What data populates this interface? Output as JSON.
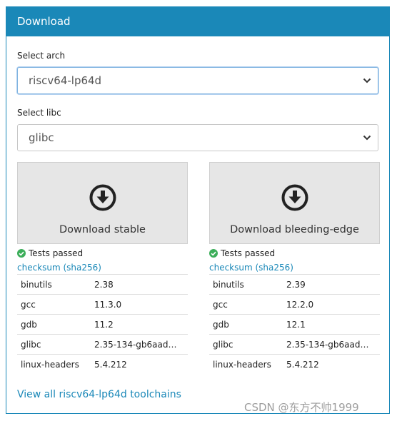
{
  "header": {
    "title": "Download"
  },
  "arch": {
    "label": "Select arch",
    "value": "riscv64-lp64d"
  },
  "libc": {
    "label": "Select libc",
    "value": "glibc"
  },
  "stable": {
    "button_label": "Download stable",
    "tests": "Tests passed",
    "checksum": "checksum (sha256)",
    "rows": [
      {
        "name": "binutils",
        "version": "2.38"
      },
      {
        "name": "gcc",
        "version": "11.3.0"
      },
      {
        "name": "gdb",
        "version": "11.2"
      },
      {
        "name": "glibc",
        "version": "2.35-134-gb6aad…"
      },
      {
        "name": "linux-headers",
        "version": "5.4.212"
      }
    ]
  },
  "bleeding": {
    "button_label": "Download bleeding-edge",
    "tests": "Tests passed",
    "checksum": "checksum (sha256)",
    "rows": [
      {
        "name": "binutils",
        "version": "2.39"
      },
      {
        "name": "gcc",
        "version": "12.2.0"
      },
      {
        "name": "gdb",
        "version": "12.1"
      },
      {
        "name": "glibc",
        "version": "2.35-134-gb6aad…"
      },
      {
        "name": "linux-headers",
        "version": "5.4.212"
      }
    ]
  },
  "view_all": "View all riscv64-lp64d toolchains",
  "watermark": "CSDN @东方不帅1999",
  "colors": {
    "accent": "#1a88b8",
    "success": "#3cae5a"
  },
  "icons": {
    "download": "download-circle-icon",
    "check": "check-circle-icon",
    "chevron": "chevron-down-icon"
  }
}
